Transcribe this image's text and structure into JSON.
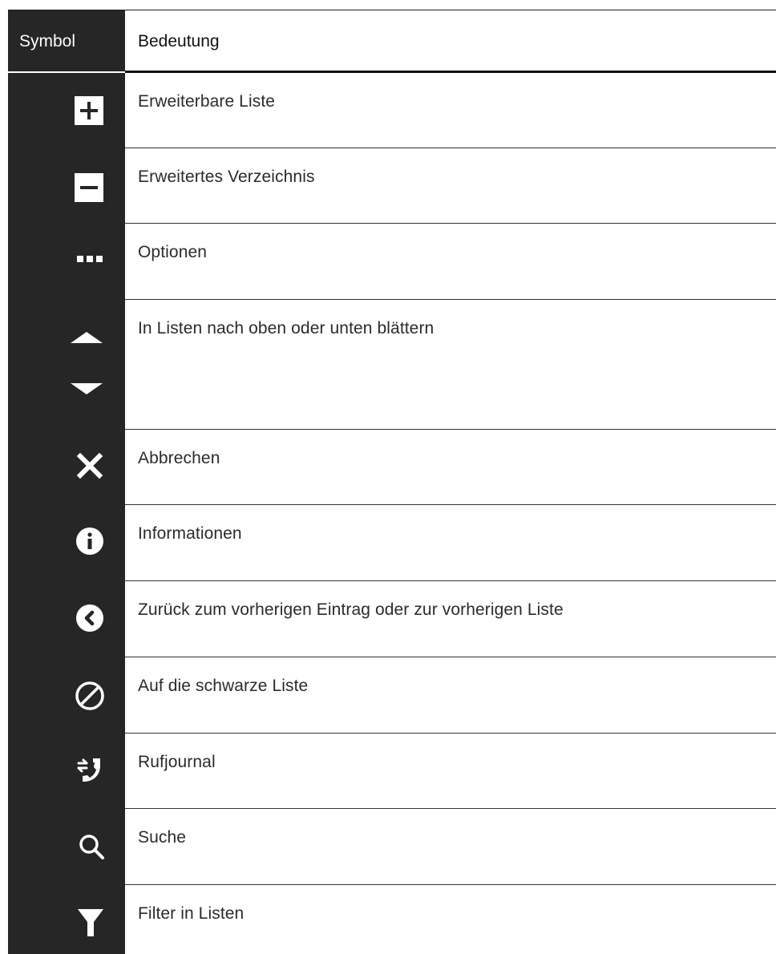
{
  "table": {
    "header": {
      "symbol": "Symbol",
      "meaning": "Bedeutung"
    },
    "rows": [
      {
        "icon": "plus-box-icon",
        "label": "Erweiterbare Liste"
      },
      {
        "icon": "minus-box-icon",
        "label": "Erweitertes Verzeichnis"
      },
      {
        "icon": "more-dots-icon",
        "label": "Optionen"
      },
      {
        "icon": "scroll-up-down-icon",
        "label": "In Listen nach oben oder unten blättern"
      },
      {
        "icon": "close-x-icon",
        "label": "Abbrechen"
      },
      {
        "icon": "info-circle-icon",
        "label": "Informationen"
      },
      {
        "icon": "back-chevron-circle-icon",
        "label": "Zurück zum vorherigen Eintrag oder zur vorherigen Liste"
      },
      {
        "icon": "blocked-circle-icon",
        "label": "Auf die schwarze Liste"
      },
      {
        "icon": "call-log-icon",
        "label": "Rufjournal"
      },
      {
        "icon": "search-icon",
        "label": "Suche"
      },
      {
        "icon": "filter-funnel-icon",
        "label": "Filter in Listen"
      }
    ]
  },
  "colors": {
    "symbol_column": "#262626",
    "icon": "#ffffff",
    "text": "#2b2b2b",
    "rule": "#333333"
  }
}
